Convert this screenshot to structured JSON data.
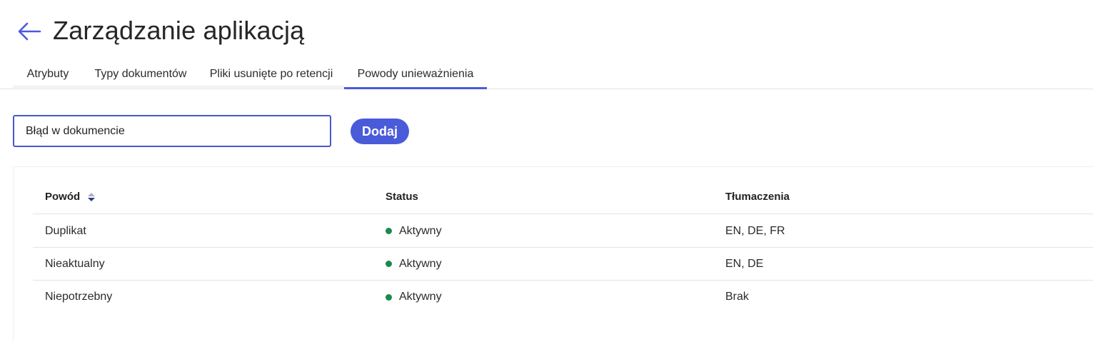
{
  "header": {
    "title": "Zarządzanie aplikacją",
    "back_icon": "arrow-left-icon",
    "accent": "#4a5bd9"
  },
  "tabs": [
    {
      "label": "Atrybuty",
      "active": false
    },
    {
      "label": "Typy dokumentów",
      "active": false
    },
    {
      "label": "Pliki usunięte po retencji",
      "active": false
    },
    {
      "label": "Powody unieważnienia",
      "active": true
    }
  ],
  "form": {
    "input_value": "Błąd w dokumencie",
    "add_label": "Dodaj"
  },
  "table": {
    "columns": [
      "Powód",
      "Status",
      "Tłumaczenia"
    ],
    "sort_icon": "sort-icon",
    "rows": [
      {
        "reason": "Duplikat",
        "status": "Aktywny",
        "translations": "EN, DE, FR"
      },
      {
        "reason": "Nieaktualny",
        "status": "Aktywny",
        "translations": "EN, DE"
      },
      {
        "reason": "Niepotrzebny",
        "status": "Aktywny",
        "translations": "Brak"
      }
    ],
    "status_color": "#1a8a4a"
  }
}
